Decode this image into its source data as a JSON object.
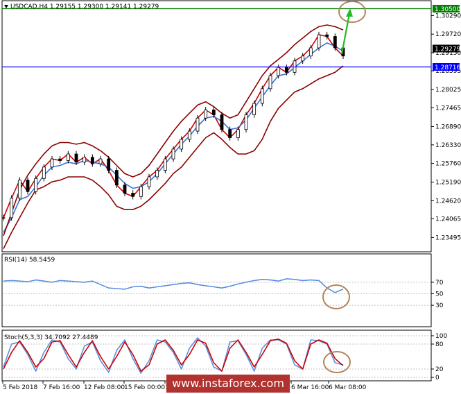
{
  "chart_data": [
    {
      "type": "candlestick",
      "title": "USDCAD,H4  1.29155 1.29300 1.29141 1.29279",
      "ylim": [
        1.2312,
        1.3068
      ],
      "y_ticks": [
        "1.30290",
        "1.29720",
        "1.29150",
        "1.28595",
        "1.28025",
        "1.27465",
        "1.26890",
        "1.26330",
        "1.25760",
        "1.25190",
        "1.24620",
        "1.24065",
        "1.23495"
      ],
      "x_ticks": [
        "5 Feb 2018",
        "7 Feb 16:00",
        "12 Feb 08:00",
        "15 Feb 00:00",
        "19",
        "6 Mar 16:00",
        "6 Mar 08:00"
      ],
      "price_tag": "1.29279",
      "price_tag_value": 1.29279,
      "levels": [
        {
          "label": "1.30500",
          "value": 1.305,
          "color": "#008000"
        },
        {
          "label": "1.28716",
          "value": 1.28716,
          "color": "#0000ff"
        }
      ],
      "series_x_range": [
        0,
        100
      ],
      "series": [
        {
          "values": [
            1.241,
            1.247,
            1.2525,
            1.249,
            1.253,
            1.2565,
            1.259,
            1.2585,
            1.2605,
            1.258,
            1.2595,
            1.2575,
            1.259,
            1.2555,
            1.251,
            1.2485,
            1.2475,
            1.2505,
            1.2535,
            1.2555,
            1.259,
            1.262,
            1.265,
            1.2675,
            1.2715,
            1.274,
            1.2725,
            1.268,
            1.2655,
            1.268,
            1.2725,
            1.276,
            1.2805,
            1.2845,
            1.287,
            1.2855,
            1.289,
            1.2905,
            1.293,
            1.297,
            1.2965,
            1.293,
            1.2905
          ],
          "color": "#cc0000"
        },
        {
          "values": [
            1.2365,
            1.241,
            1.2465,
            1.2475,
            1.2505,
            1.254,
            1.2565,
            1.257,
            1.258,
            1.2575,
            1.2585,
            1.258,
            1.2575,
            1.2565,
            1.254,
            1.2515,
            1.25,
            1.2505,
            1.252,
            1.2545,
            1.2575,
            1.2605,
            1.2635,
            1.266,
            1.269,
            1.2715,
            1.272,
            1.2705,
            1.268,
            1.2685,
            1.271,
            1.2745,
            1.278,
            1.2815,
            1.2845,
            1.285,
            1.287,
            1.289,
            1.291,
            1.293,
            1.2945,
            1.2935,
            1.292
          ],
          "color": "#3a6fd8"
        },
        {
          "values": [
            1.2355,
            1.2425,
            1.2495,
            1.254,
            1.2575,
            1.2605,
            1.263,
            1.264,
            1.264,
            1.2635,
            1.264,
            1.263,
            1.2615,
            1.2595,
            1.257,
            1.2545,
            1.2535,
            1.2545,
            1.257,
            1.2605,
            1.264,
            1.2675,
            1.2705,
            1.273,
            1.2755,
            1.2765,
            1.275,
            1.273,
            1.2715,
            1.2725,
            1.2765,
            1.2805,
            1.2845,
            1.2875,
            1.2895,
            1.2915,
            1.294,
            1.296,
            1.298,
            1.2995,
            1.3,
            1.2995,
            1.2985
          ],
          "color": "#8b0000"
        },
        {
          "values": [
            1.2315,
            1.2365,
            1.241,
            1.2455,
            1.2495,
            1.2505,
            1.252,
            1.2525,
            1.2535,
            1.2535,
            1.2535,
            1.2525,
            1.2505,
            1.248,
            1.2445,
            1.2435,
            1.2435,
            1.2445,
            1.2465,
            1.249,
            1.2515,
            1.2545,
            1.2565,
            1.2595,
            1.2625,
            1.2655,
            1.267,
            1.265,
            1.2625,
            1.2605,
            1.2605,
            1.2615,
            1.265,
            1.2705,
            1.2745,
            1.277,
            1.2795,
            1.2805,
            1.282,
            1.2835,
            1.2845,
            1.2855,
            1.2875
          ],
          "color": "#8b0000"
        }
      ]
    },
    {
      "type": "line",
      "title": "RSI(14) 58.5459",
      "ylim": [
        0,
        100
      ],
      "y_ticks": [
        "70",
        "50",
        "30"
      ],
      "series_x_range": [
        0,
        100
      ],
      "series": [
        {
          "values": [
            72,
            73,
            72,
            71,
            74,
            72,
            70,
            73,
            72,
            71,
            70,
            72,
            66,
            60,
            59,
            58,
            62,
            63,
            60,
            62,
            64,
            66,
            68,
            69,
            66,
            64,
            62,
            60,
            63,
            67,
            70,
            73,
            75,
            74,
            72,
            76,
            75,
            73,
            74,
            73,
            60,
            52,
            58
          ],
          "color": "#5b8fe0"
        }
      ]
    },
    {
      "type": "line",
      "title": "Stoch(5,3,3) 34.7092 27.4489",
      "ylim": [
        0,
        100
      ],
      "y_ticks": [
        "100",
        "80",
        "20",
        "0"
      ],
      "series_x_range": [
        0,
        100
      ],
      "series": [
        {
          "values": [
            25,
            80,
            85,
            55,
            15,
            60,
            90,
            85,
            45,
            20,
            75,
            85,
            40,
            12,
            65,
            90,
            45,
            10,
            40,
            90,
            85,
            60,
            20,
            70,
            95,
            75,
            25,
            15,
            85,
            88,
            55,
            15,
            70,
            90,
            90,
            80,
            30,
            20,
            90,
            88,
            80,
            35,
            30
          ],
          "color": "#5b8fe0"
        },
        {
          "values": [
            20,
            60,
            88,
            60,
            25,
            45,
            85,
            88,
            55,
            25,
            60,
            88,
            50,
            20,
            50,
            85,
            55,
            15,
            30,
            80,
            90,
            65,
            30,
            55,
            90,
            82,
            35,
            15,
            70,
            90,
            60,
            25,
            55,
            88,
            92,
            82,
            40,
            20,
            80,
            90,
            82,
            45,
            28
          ],
          "color": "#cc0000"
        }
      ]
    }
  ],
  "watermark": "www.instaforex.com"
}
